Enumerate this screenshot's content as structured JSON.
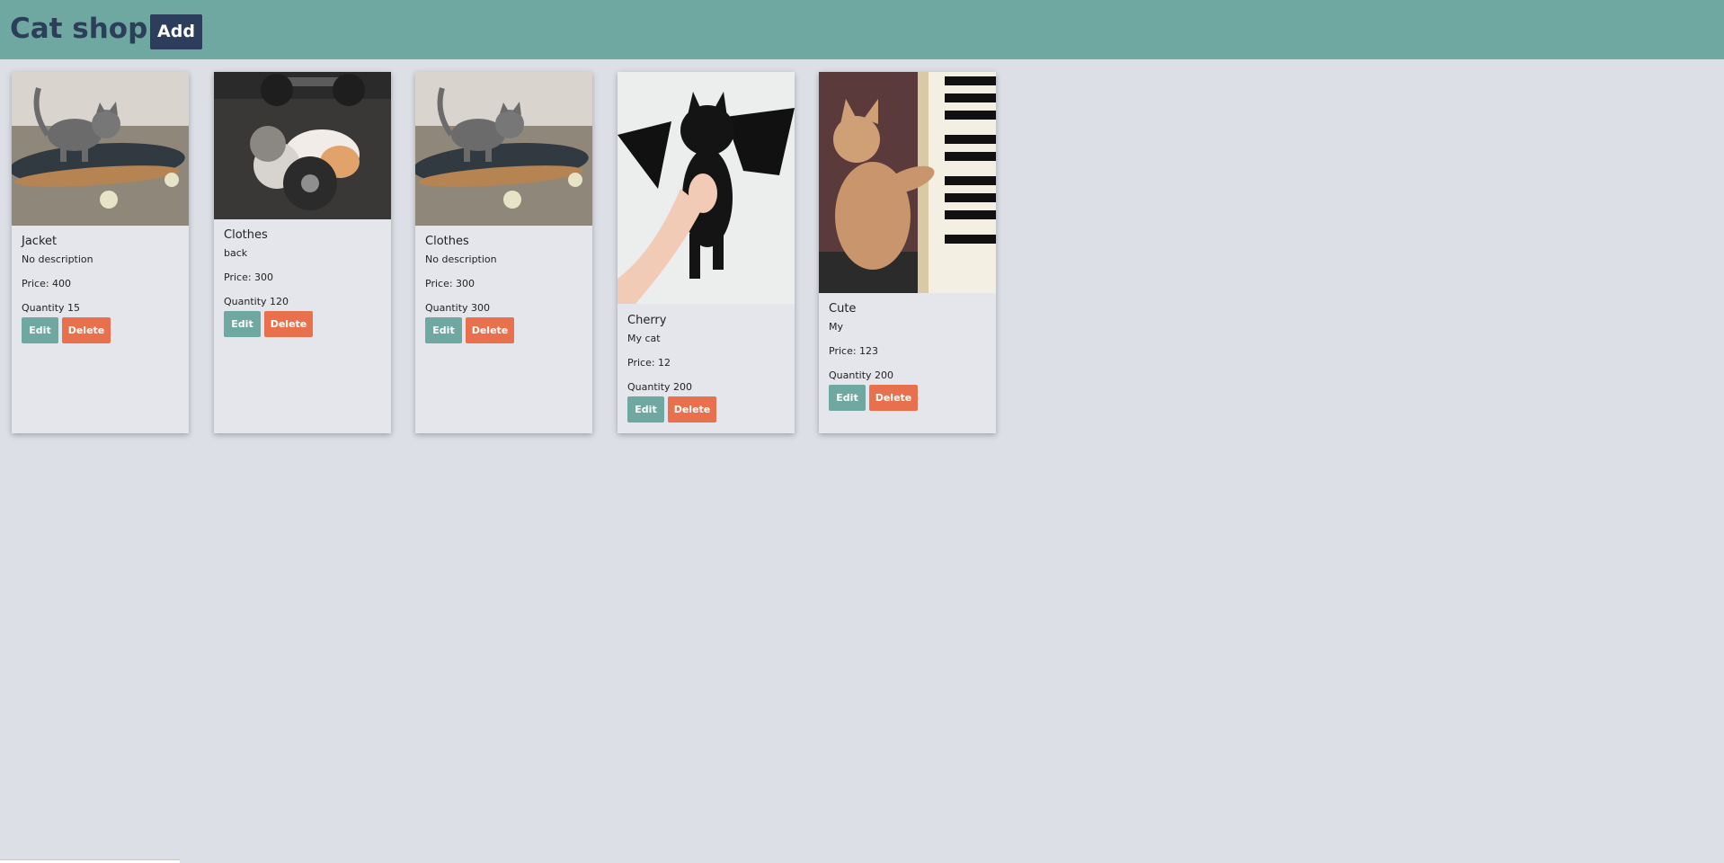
{
  "header": {
    "title": "Cat shop",
    "add_label": "Add",
    "bg_color": "#6fa8a0",
    "title_color": "#2c3e5a"
  },
  "actions": {
    "edit_label": "Edit",
    "delete_label": "Delete",
    "edit_color": "#6fa8a0",
    "delete_color": "#e9704d"
  },
  "products": [
    {
      "name": "Jacket",
      "description": "No description",
      "price": "Price: 400",
      "quantity": "Quantity 15",
      "image": "kitten-on-skateboard"
    },
    {
      "name": "Clothes",
      "description": "back",
      "price": "Price: 300",
      "quantity": "Quantity 120",
      "image": "kitten-with-dumbbells"
    },
    {
      "name": "Clothes",
      "description": "No description",
      "price": "Price: 300",
      "quantity": "Quantity 300",
      "image": "kitten-on-skateboard"
    },
    {
      "name": "Cherry",
      "description": "My cat",
      "price": "Price: 12",
      "quantity": "Quantity 200",
      "image": "black-kitten-with-bat-wings"
    },
    {
      "name": "Cute",
      "description": "My",
      "price": "Price: 123",
      "quantity": "Quantity 200",
      "image": "kitten-playing-piano"
    }
  ]
}
